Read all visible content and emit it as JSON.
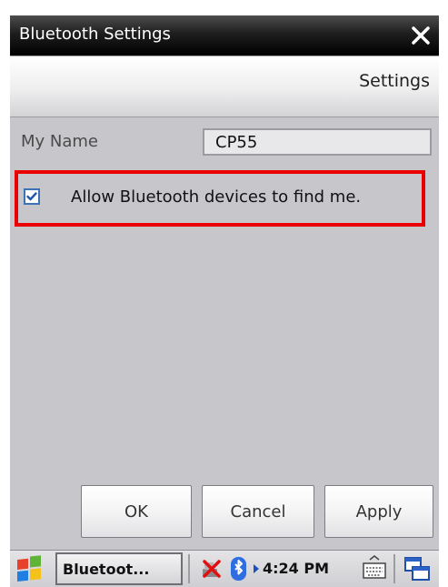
{
  "window": {
    "title": "Bluetooth Settings",
    "close_icon": "close-x-icon",
    "header_tab": "Settings"
  },
  "form": {
    "name_label": "My Name",
    "name_value": "CP55",
    "allow_find_checked": true,
    "allow_find_label": "Allow Bluetooth devices to find me."
  },
  "buttons": {
    "ok": "OK",
    "cancel": "Cancel",
    "apply": "Apply"
  },
  "taskbar": {
    "start_icon": "windows-flag-icon",
    "task_label": "Bluetoot...",
    "network_icon": "network-disconnected-icon",
    "bluetooth_icon": "bluetooth-icon",
    "clock": "4:24 PM",
    "keyboard_icon": "keyboard-icon",
    "window_switch_icon": "window-switch-icon"
  },
  "colors": {
    "highlight_border": "#ea0000",
    "title_bar": "#000000",
    "body_background": "#c7c7cb"
  }
}
